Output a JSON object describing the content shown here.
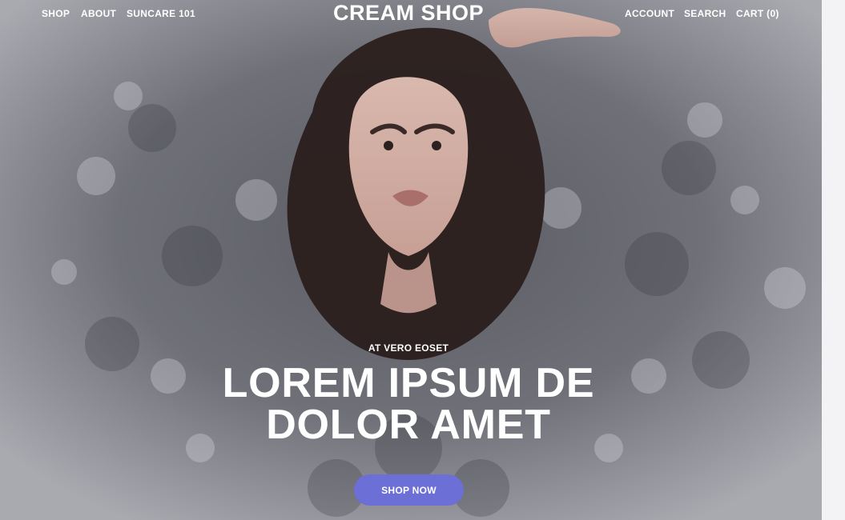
{
  "nav": {
    "left": [
      "SHOP",
      "ABOUT",
      "SUNCARE 101"
    ],
    "brand": "CREAM SHOP",
    "right": [
      "ACCOUNT",
      "SEARCH",
      "CART (0)"
    ]
  },
  "hero": {
    "eyebrow": "AT VERO EOSET",
    "headline_lines": [
      "LOREM IPSUM DE",
      "DOLOR AMET"
    ],
    "cta_label": "SHOP NOW",
    "image": "woman-in-sequins-photo"
  },
  "colors": {
    "accent": "#6b6fd6",
    "hero_gray": "#a6a7ad",
    "text": "#ffffff"
  }
}
